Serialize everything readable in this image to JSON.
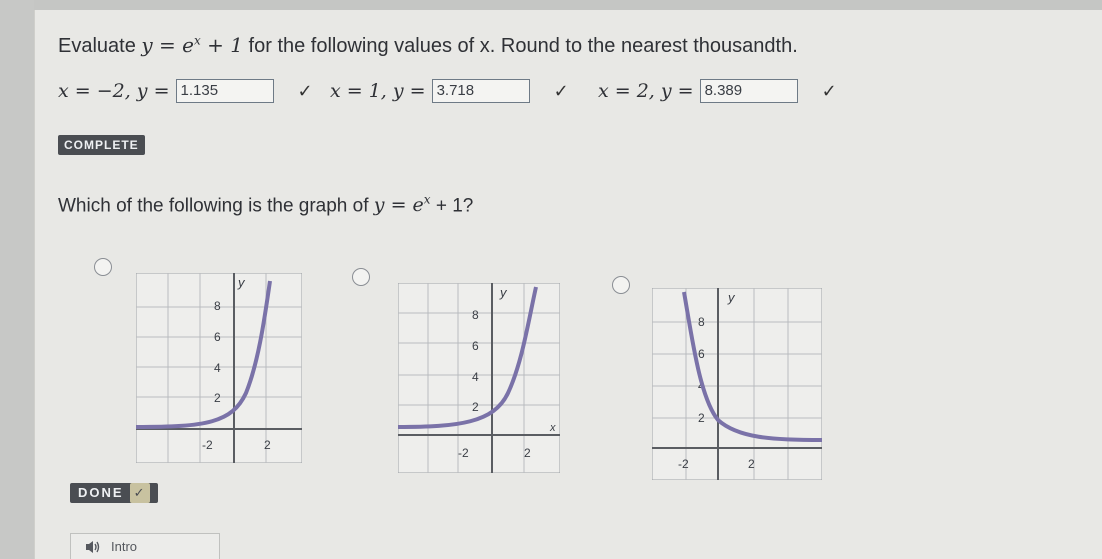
{
  "question1": {
    "prefix": "Evaluate ",
    "function": "y = e",
    "exponent": "x",
    "suffix_math": " + 1",
    "text": " for the following values of x. Round to the nearest thousandth."
  },
  "answers": [
    {
      "equation": "x = −2, y =",
      "value": "1.135",
      "check": "✓"
    },
    {
      "equation": "x = 1, y =",
      "value": "3.718",
      "check": "✓"
    },
    {
      "equation": "x = 2, y =",
      "value": "8.389",
      "check": "✓"
    }
  ],
  "complete_badge": "COMPLETE",
  "question2": {
    "prefix": "Which of the following is the graph of ",
    "function": "y = e",
    "exponent": "x",
    "suffix": " + 1?"
  },
  "graph_labels": {
    "y_axis": "y",
    "x_axis": "x",
    "y_ticks": [
      "8",
      "6",
      "4",
      "2"
    ],
    "x_ticks": [
      "-2",
      "2"
    ]
  },
  "done_button": {
    "label": "DONE",
    "check": "✓"
  },
  "intro_button": {
    "label": "Intro",
    "icon": "speaker-icon"
  },
  "colors": {
    "curve": "#7a72a8",
    "accent": "#4a4d52"
  }
}
